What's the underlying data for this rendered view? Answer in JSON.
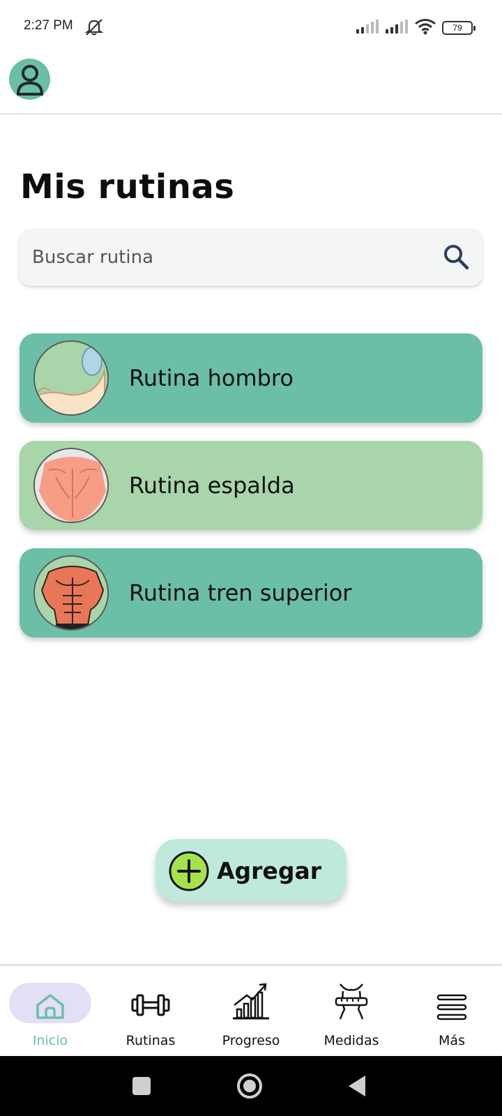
{
  "status_bar": {
    "time": "2:27 PM",
    "battery": "79"
  },
  "page": {
    "title": "Mis rutinas"
  },
  "search": {
    "placeholder": "Buscar rutina"
  },
  "routines": [
    {
      "label": "Rutina hombro",
      "color": "#6bbfa7"
    },
    {
      "label": "Rutina espalda",
      "color": "#a9d5aa"
    },
    {
      "label": "Rutina tren superior",
      "color": "#6bbfa7"
    }
  ],
  "add_button": {
    "label": "Agregar"
  },
  "bottom_nav": {
    "items": [
      {
        "label": "Inicio",
        "icon": "home-icon",
        "active": true
      },
      {
        "label": "Rutinas",
        "icon": "dumbbell-icon",
        "active": false
      },
      {
        "label": "Progreso",
        "icon": "chart-icon",
        "active": false
      },
      {
        "label": "Medidas",
        "icon": "measure-icon",
        "active": false
      },
      {
        "label": "Más",
        "icon": "menu-icon",
        "active": false
      }
    ]
  },
  "colors": {
    "accent": "#6bbfa7",
    "accent_light": "#bfe9dc",
    "active_pill": "#e4def7",
    "plus_green": "#a6e34b"
  }
}
